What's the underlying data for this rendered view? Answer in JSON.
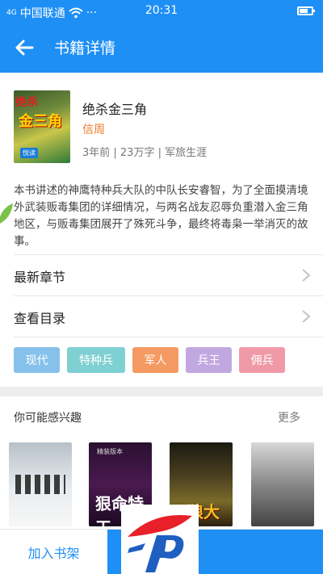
{
  "status_bar": {
    "signal": "4G",
    "carrier": "中国联通",
    "time": "20:31",
    "overflow": "···",
    "battery_level": 0.6
  },
  "header": {
    "title": "书籍详情"
  },
  "book": {
    "title": "绝杀金三角",
    "author": "信周",
    "meta": "3年前 | 23万字 | 军旅生涯",
    "cover_text": "金三角",
    "cover_small": "绝杀",
    "cover_pub": "悦读"
  },
  "description": "本书讲述的神鹰特种兵大队的中队长安睿智，为了全面摸清境外武装贩毒集团的详细情况，与两名战友忍辱负重潜入金三角地区，与贩毒集团展开了殊死斗争，最终将毒枭一举消灭的故事。",
  "rows": {
    "latest": "最新章节",
    "catalog": "查看目录"
  },
  "tags": [
    {
      "label": "现代",
      "color": "#86c1ec"
    },
    {
      "label": "特种兵",
      "color": "#7fd0d2"
    },
    {
      "label": "军人",
      "color": "#f59a62"
    },
    {
      "label": "兵王",
      "color": "#c2a8e0"
    },
    {
      "label": "佣兵",
      "color": "#f09aa8"
    }
  ],
  "recommend": {
    "title": "你可能感兴趣",
    "more": "更多",
    "books": [
      {
        "cover_text": ""
      },
      {
        "cover_text": "狠命特工",
        "cover_small": "精装版本"
      },
      {
        "cover_text": "天狼大队"
      },
      {
        "cover_text": ""
      }
    ]
  },
  "bottom": {
    "add_shelf": "加入书架"
  },
  "colors": {
    "primary": "#1e8ff5",
    "author": "#ef7b2c"
  }
}
